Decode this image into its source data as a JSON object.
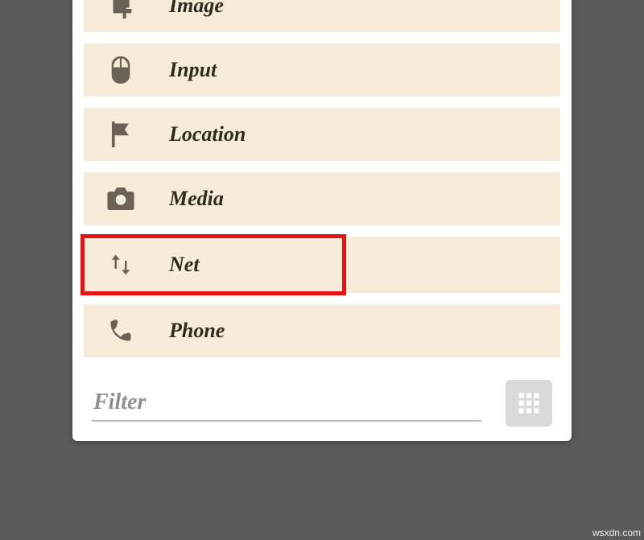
{
  "categories": [
    {
      "label": "Image",
      "icon": "crop-icon",
      "highlighted": false
    },
    {
      "label": "Input",
      "icon": "mouse-icon",
      "highlighted": false
    },
    {
      "label": "Location",
      "icon": "flag-icon",
      "highlighted": false
    },
    {
      "label": "Media",
      "icon": "camera-icon",
      "highlighted": false
    },
    {
      "label": "Net",
      "icon": "net-icon",
      "highlighted": true
    },
    {
      "label": "Phone",
      "icon": "phone-icon",
      "highlighted": false
    }
  ],
  "filter": {
    "placeholder": "Filter"
  },
  "watermark": "wsxdn.com",
  "colors": {
    "item_bg": "#f7ecd9",
    "highlight_border": "#e81212",
    "icon": "#6b6257",
    "text": "#2d2a1f",
    "panel_bg": "#ffffff",
    "outer_bg": "#5a5a5a"
  }
}
